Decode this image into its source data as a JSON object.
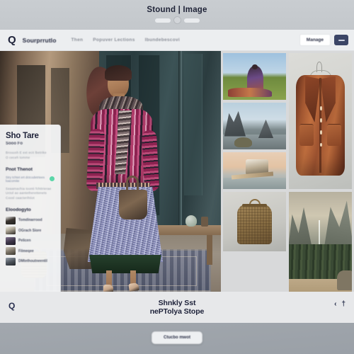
{
  "window": {
    "title": "Stound | Image",
    "segmented_control": [
      "left-segment",
      "knob",
      "right-segment"
    ]
  },
  "topbar": {
    "logo_icon": "magnifier-q-icon",
    "brand": "Sourprrutlo",
    "nav_links": [
      "Then",
      "Popuver Lections",
      "Ibundebescovi"
    ],
    "cta_label": "Manage",
    "menu_icon": "hamburger-icon"
  },
  "side_panel": {
    "title": "Sho Tare",
    "subtitle": "Sooo Fo",
    "lines": [
      "Brouush E ext ecit lbetrike",
      "O ceceh tomme"
    ],
    "section_a": {
      "heading": "Pnot Thenot",
      "status_text": "Stry tchtet ert dctcodetrtees loacomite",
      "status_dot_color": "#5bd6a8",
      "lines": [
        "Seaamachia toonti fchttrierae",
        "Uctol ao aantetherettenets",
        "Coosl caacterihtiot"
      ]
    },
    "section_b": {
      "heading": "Eloodogyto",
      "items": [
        {
          "label": "Tomdinarrood",
          "thumb": "thumb-handbag"
        },
        {
          "label": "OGrach Siore",
          "thumb": "thumb-sunglasses"
        },
        {
          "label": "Pelicen",
          "thumb": "thumb-person"
        },
        {
          "label": "Filmeqee",
          "thumb": "thumb-interior"
        },
        {
          "label": "DMtethoutneentil",
          "thumb": "thumb-landscape"
        }
      ]
    }
  },
  "hero": {
    "alt": "woman-in-patterned-dress-storefront"
  },
  "grid": {
    "tiles": [
      {
        "name": "woman-on-grass-field"
      },
      {
        "name": "rocky-coastline"
      },
      {
        "name": "brown-leather-jacket-on-hanger"
      },
      {
        "name": "wooden-bench-at-sunset"
      },
      {
        "name": "burlap-backpack"
      },
      {
        "name": "mountain-valley-waterfall"
      }
    ]
  },
  "caption": {
    "line1": "Shnkly Sst",
    "line2": "nePTolya Stope",
    "left_icon": "search-q-icon",
    "right_icons": [
      "chevron-icon",
      "info-icon"
    ]
  },
  "dock": {
    "button_label": "Ctucbo mwot"
  }
}
